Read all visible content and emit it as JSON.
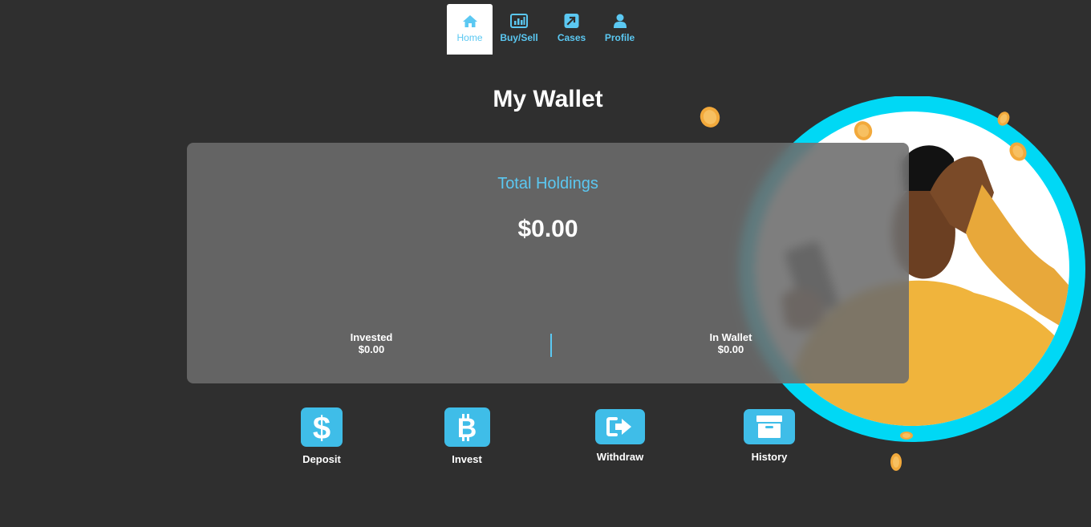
{
  "nav": {
    "items": [
      {
        "label": "Home",
        "icon": "home-icon",
        "active": true
      },
      {
        "label": "Buy/Sell",
        "icon": "chart-icon",
        "active": false
      },
      {
        "label": "Cases",
        "icon": "arrow-up-right-icon",
        "active": false
      },
      {
        "label": "Profile",
        "icon": "user-icon",
        "active": false
      }
    ]
  },
  "page": {
    "title": "My Wallet"
  },
  "wallet": {
    "total_label": "Total Holdings",
    "total_value": "$0.00",
    "invested_label": "Invested",
    "invested_value": "$0.00",
    "in_wallet_label": "In Wallet",
    "in_wallet_value": "$0.00"
  },
  "actions": [
    {
      "label": "Deposit",
      "icon": "dollar-icon"
    },
    {
      "label": "Invest",
      "icon": "bitcoin-icon"
    },
    {
      "label": "Withdraw",
      "icon": "sign-out-icon"
    },
    {
      "label": "History",
      "icon": "archive-icon"
    }
  ],
  "colors": {
    "background": "#2f2f2f",
    "accent": "#5bc8f2",
    "tile": "#3fbde8",
    "ring": "#00d8f5",
    "sweater": "#f0b43c"
  }
}
